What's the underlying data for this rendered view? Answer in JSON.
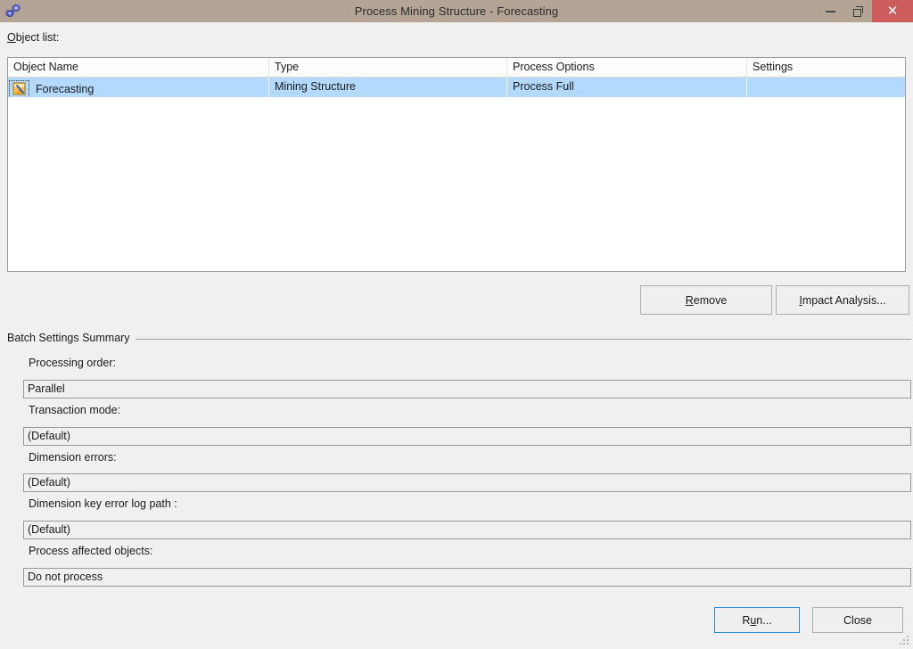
{
  "window": {
    "title": "Process Mining Structure - Forecasting",
    "app_icon": "mining-structure-icon",
    "controls": {
      "minimize": "minimize-icon",
      "restore": "restore-icon",
      "close": "close-icon",
      "close_glyph": "✕"
    },
    "accent": {
      "titlebar": "#b3a496",
      "close_button": "#cd5c5c",
      "selection": "#b3d9fd",
      "default_button_border": "#2a8ad4",
      "dialog_background": "#f0f0f0"
    }
  },
  "object_list": {
    "label_prefix": "",
    "label_accel": "O",
    "label_rest": "bject list:",
    "columns": [
      {
        "key": "name",
        "header": "Object Name"
      },
      {
        "key": "type",
        "header": "Type"
      },
      {
        "key": "options",
        "header": "Process Options"
      },
      {
        "key": "settings",
        "header": "Settings"
      }
    ],
    "rows": [
      {
        "icon": "mining-structure-item-icon",
        "name": "Forecasting",
        "type": "Mining Structure",
        "options": "Process Full",
        "settings": ""
      }
    ]
  },
  "actions": {
    "remove": {
      "accel": "R",
      "rest": "emove"
    },
    "impact_analysis": {
      "accel": "I",
      "rest": "mpact Analysis..."
    }
  },
  "batch_settings": {
    "group_title": "Batch Settings Summary",
    "fields": [
      {
        "label": "Processing order:",
        "value": "Parallel"
      },
      {
        "label": "Transaction mode:",
        "value": "(Default)"
      },
      {
        "label": "Dimension errors:",
        "value": "(Default)"
      },
      {
        "label": "Dimension key error log path :",
        "value": "(Default)"
      },
      {
        "label": "Process affected objects:",
        "value": "Do not process"
      }
    ]
  },
  "footer": {
    "run": {
      "pre": "R",
      "accel": "u",
      "rest": "n..."
    },
    "close": "Close"
  }
}
